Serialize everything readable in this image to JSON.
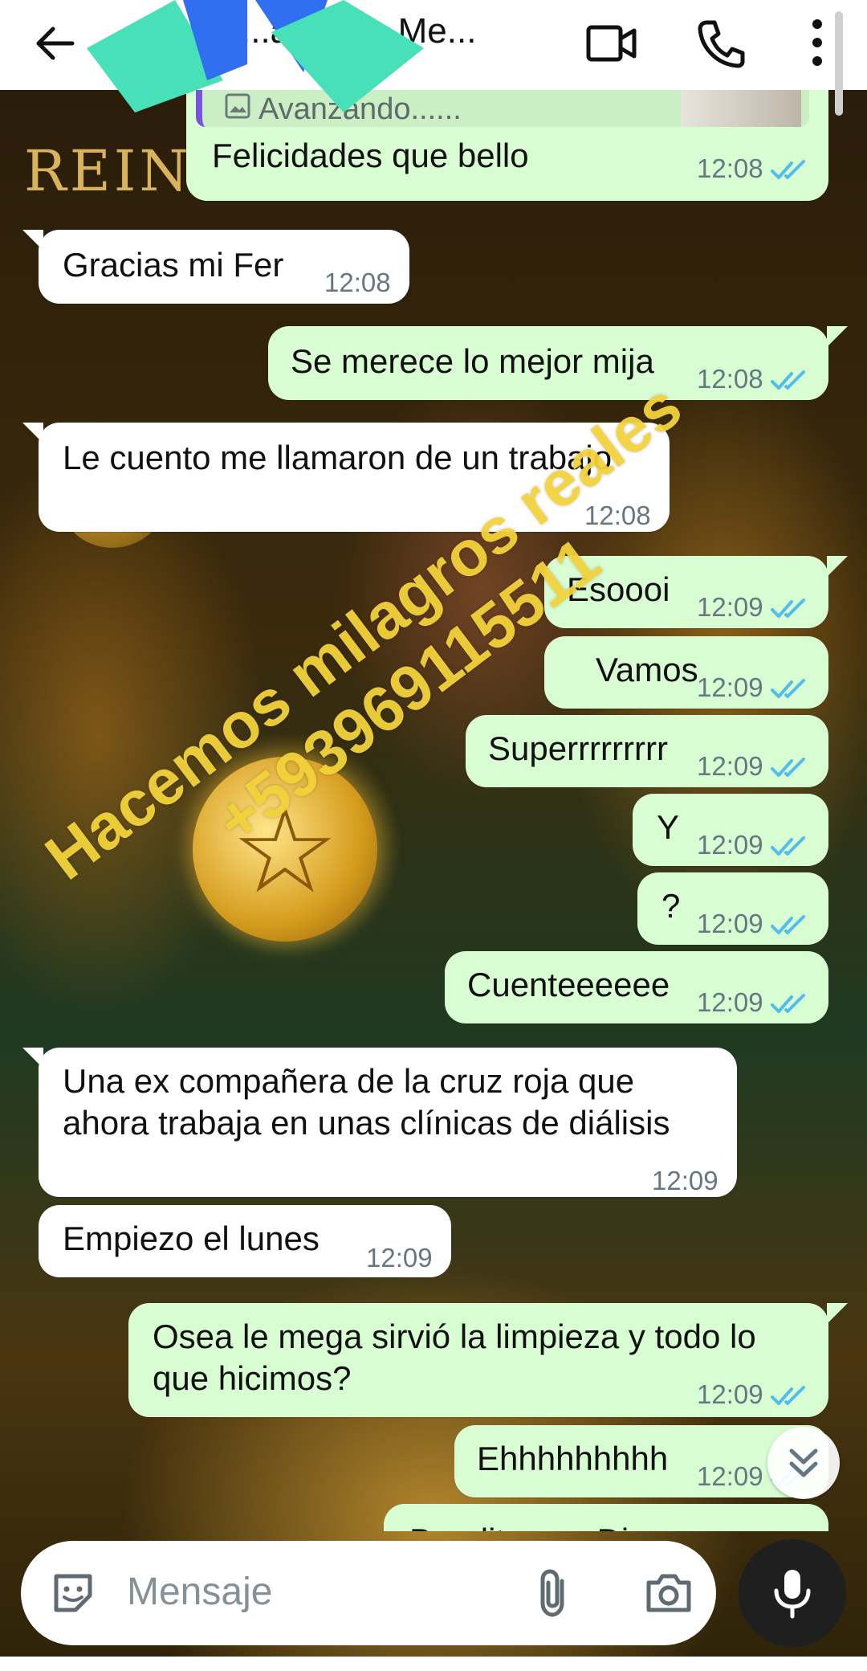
{
  "header": {
    "contact_name": "...ar...eira Me...",
    "icons": [
      "back-arrow-icon",
      "video-call-icon",
      "phone-icon",
      "more-vert-icon"
    ]
  },
  "reply_preview": {
    "text": "Avanzando......",
    "icon": "image-icon"
  },
  "messages": [
    {
      "dir": "out",
      "text": "Felicidades que bello",
      "time": "12:08",
      "read": true
    },
    {
      "dir": "in",
      "text": "Gracias mi Fer",
      "time": "12:08"
    },
    {
      "dir": "out",
      "text": "Se merece lo mejor mija",
      "time": "12:08",
      "read": true
    },
    {
      "dir": "in",
      "text": "Le cuento me llamaron de un trabajo",
      "time": "12:08"
    },
    {
      "dir": "out",
      "text": "Esoooi",
      "time": "12:09",
      "read": true
    },
    {
      "dir": "out",
      "text": "Vamos",
      "time": "12:09",
      "read": true
    },
    {
      "dir": "out",
      "text": "Superrrrrrrrr",
      "time": "12:09",
      "read": true
    },
    {
      "dir": "out",
      "text": "Y",
      "time": "12:09",
      "read": true
    },
    {
      "dir": "out",
      "text": "?",
      "time": "12:09",
      "read": true
    },
    {
      "dir": "out",
      "text": "Cuenteeeeee",
      "time": "12:09",
      "read": true
    },
    {
      "dir": "in",
      "text_line1": "Una ex compañera de la cruz roja que",
      "text_line2": "ahora trabaja en unas clínicas de diálisis",
      "time": "12:09"
    },
    {
      "dir": "in",
      "text": "Empiezo el lunes",
      "time": "12:09"
    },
    {
      "dir": "out",
      "text_line1": "Osea le mega sirvió la limpieza y todo lo",
      "text_line2": "que hicimos?",
      "time": "12:09",
      "read": true
    },
    {
      "dir": "out",
      "text": "Ehhhhhhhhh",
      "time": "12:09",
      "read": true
    },
    {
      "dir": "out",
      "text": "Bendito sea Dios",
      "partial": true
    }
  ],
  "watermark": {
    "line1": "Hacemos milagros reales",
    "line2": "+593969115511"
  },
  "background": {
    "art_text": "REINA"
  },
  "composer": {
    "placeholder": "Mensaje",
    "icons": [
      "emoji-icon",
      "attach-icon",
      "camera-icon",
      "mic-icon"
    ]
  },
  "colors": {
    "outgoing_bubble": "#d9fdd3",
    "incoming_bubble": "#ffffff",
    "read_ticks": "#53bdeb",
    "watermark": "#f2d23a"
  }
}
